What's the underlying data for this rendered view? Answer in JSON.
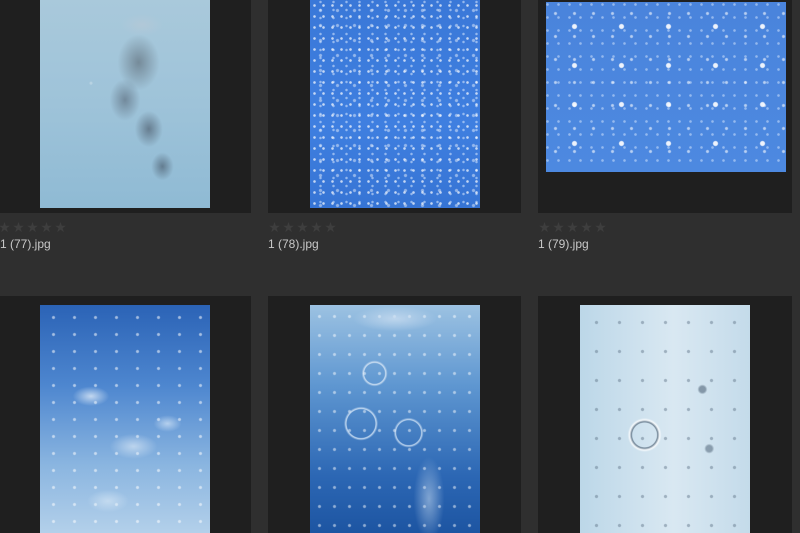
{
  "thumbnails": [
    {
      "filename": "1 (77).jpg",
      "rating_stars": [
        "★",
        "★",
        "★",
        "★",
        "★"
      ]
    },
    {
      "filename": "1 (78).jpg",
      "rating_stars": [
        "★",
        "★",
        "★",
        "★",
        "★"
      ]
    },
    {
      "filename": "1 (79).jpg",
      "rating_stars": [
        "★",
        "★",
        "★",
        "★",
        "★"
      ]
    },
    {
      "filename": "",
      "rating_stars": []
    },
    {
      "filename": "",
      "rating_stars": []
    },
    {
      "filename": "",
      "rating_stars": []
    }
  ]
}
